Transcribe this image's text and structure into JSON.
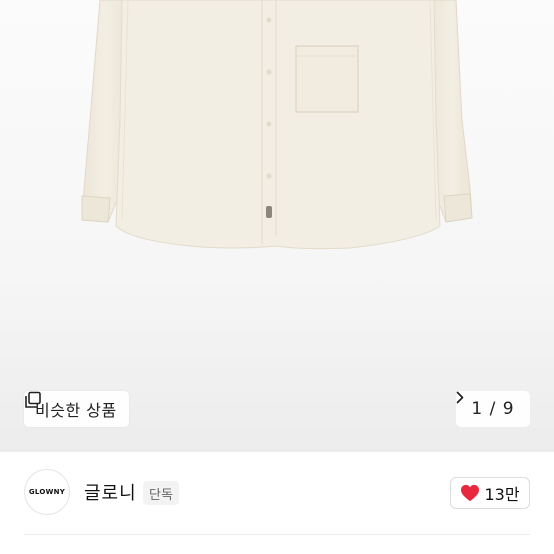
{
  "gallery": {
    "similar_label": "비슷한 상품",
    "pager_text": "1 / 9",
    "icons": {
      "similar": "copy-icon",
      "next": "chevron-right-icon"
    }
  },
  "store": {
    "logo_text": "GLOWNY",
    "name": "글로니",
    "badge": "단독",
    "likes": "13만",
    "icons": {
      "like": "heart-icon"
    }
  },
  "colors": {
    "shirt": "#f1ece0",
    "heart": "#e8283c",
    "text": "#222222"
  }
}
